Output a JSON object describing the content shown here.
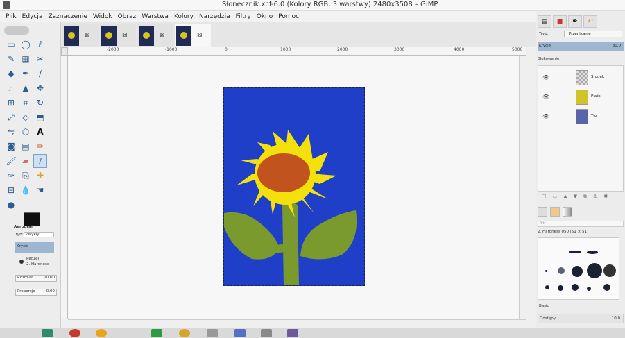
{
  "window": {
    "title": "Słonecznik.xcf-6.0 (Kolory RGB, 3 warstwy) 2480x3508 – GIMP"
  },
  "menu": [
    "Plik",
    "Edycja",
    "Zaznaczenie",
    "Widok",
    "Obraz",
    "Warstwa",
    "Kolory",
    "Narzędzia",
    "Filtry",
    "Okno",
    "Pomoc"
  ],
  "tool_options": {
    "title": "Aerograf",
    "mode_label": "Tryb:",
    "mode_value": "Zwykły",
    "opacity_label": "Krycie",
    "brush_label": "Pędzel",
    "brush_name": "2. Hardness",
    "size_label": "Rozmiar",
    "size_value": "20,00",
    "aspect_label": "Proporcje",
    "aspect_value": "0,00"
  },
  "ruler": {
    "h_ticks": [
      "-2000",
      "-1000",
      "0",
      "1000",
      "2000",
      "3000",
      "4000",
      "5000"
    ]
  },
  "layers_panel": {
    "mode_label": "Tryb:",
    "mode_value": "Przenikanie",
    "opacity_label": "Krycie",
    "opacity_value": "80,0",
    "lock_label": "Blokowanie:",
    "layers": [
      "Środek",
      "Płatki",
      "Tło"
    ]
  },
  "brushes_panel": {
    "filter_placeholder": "filtr",
    "selected_brush": "2. Hardness 050 (51 × 51)",
    "brush_set": "Basic",
    "spacing_label": "Odstępy",
    "spacing_value": "10,0"
  },
  "colors": {
    "foreground": "#0f0f0f",
    "background": "#ffffff",
    "image_sky": "#1f3fc9",
    "petals": "#f4e10c",
    "center": "#c1531f",
    "stem": "#7a9a2e"
  }
}
